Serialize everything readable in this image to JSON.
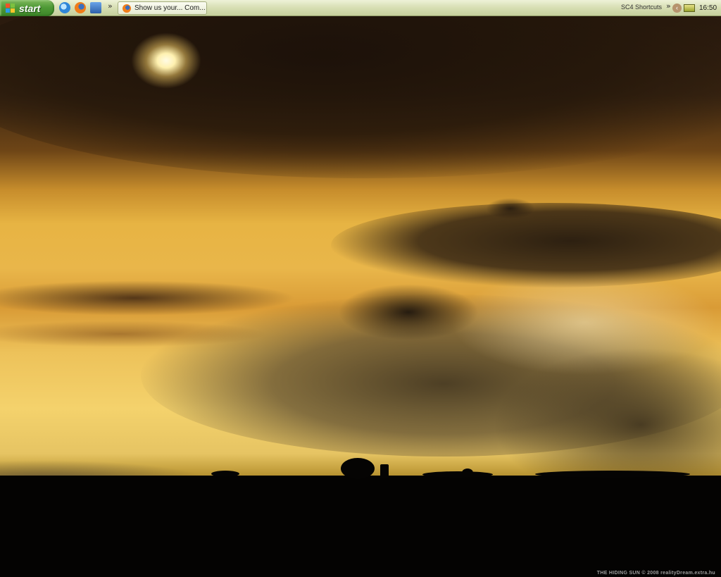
{
  "taskbar": {
    "start_label": "start",
    "quick_launch": [
      {
        "name": "internet-explorer-icon"
      },
      {
        "name": "firefox-icon"
      },
      {
        "name": "show-desktop-icon"
      }
    ],
    "chevron": "»",
    "tasks": [
      {
        "label": "Show us your... Com...",
        "icon": "firefox-icon"
      }
    ],
    "toolbar_label": "SC4 Shortcuts",
    "toolbar_chevron": "»",
    "tray_expand": "‹",
    "clock": "16:50"
  },
  "wallpaper": {
    "watermark": "THE HIDING SUN  © 2008 realityDream.extra.hu"
  },
  "colors": {
    "taskbar": "#d9e0b6",
    "start_button": "#4f9a36"
  }
}
